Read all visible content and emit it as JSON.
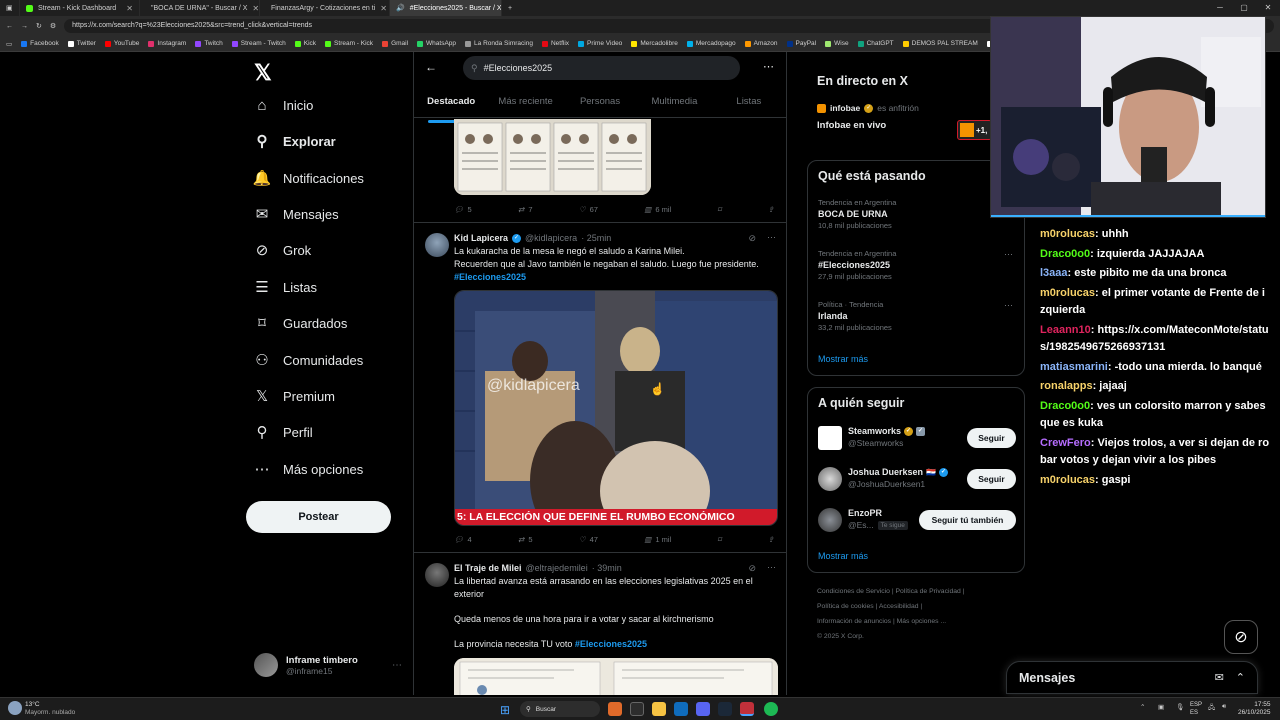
{
  "browser": {
    "tabs": [
      {
        "label": "Stream - Kick Dashboard",
        "color": "#53fc18"
      },
      {
        "label": "\"BOCA DE URNA\" - Buscar / X",
        "color": "#ffffff"
      },
      {
        "label": "FinanzasArgy - Cotizaciones en ti",
        "color": "#1a73e8"
      },
      {
        "label": "#Elecciones2025 - Buscar / X",
        "color": "#ffffff"
      }
    ],
    "url": "https://x.com/search?q=%23Elecciones2025&src=trend_click&vertical=trends",
    "bookmarks": [
      {
        "label": "Facebook",
        "color": "#1877f2"
      },
      {
        "label": "Twitter",
        "color": "#ffffff"
      },
      {
        "label": "YouTube",
        "color": "#ff0000"
      },
      {
        "label": "Instagram",
        "color": "#e1306c"
      },
      {
        "label": "Twitch",
        "color": "#9146ff"
      },
      {
        "label": "Stream - Twitch",
        "color": "#9146ff"
      },
      {
        "label": "Kick",
        "color": "#53fc18"
      },
      {
        "label": "Stream - Kick",
        "color": "#53fc18"
      },
      {
        "label": "Gmail",
        "color": "#ea4335"
      },
      {
        "label": "WhatsApp",
        "color": "#25d366"
      },
      {
        "label": "La Ronda Simracing",
        "color": "#999999"
      },
      {
        "label": "Netflix",
        "color": "#e50914"
      },
      {
        "label": "Prime Video",
        "color": "#00a8e1"
      },
      {
        "label": "Mercadolibre",
        "color": "#ffe600"
      },
      {
        "label": "Mercadopago",
        "color": "#00b1ea"
      },
      {
        "label": "Amazon",
        "color": "#ff9900"
      },
      {
        "label": "PayPal",
        "color": "#003087"
      },
      {
        "label": "Wise",
        "color": "#9fe870"
      },
      {
        "label": "ChatGPT",
        "color": "#10a37f"
      },
      {
        "label": "DEMOS PAL STREAM",
        "color": "#ffcc00"
      },
      {
        "label": "JUAN TUR",
        "color": "#ffffff"
      }
    ]
  },
  "sidebar": {
    "items": [
      {
        "label": "Inicio",
        "icon": "home-icon",
        "glyph": "⌂"
      },
      {
        "label": "Explorar",
        "icon": "search-icon",
        "glyph": "⚲"
      },
      {
        "label": "Notificaciones",
        "icon": "bell-icon",
        "glyph": "🔔"
      },
      {
        "label": "Mensajes",
        "icon": "envelope-icon",
        "glyph": "✉"
      },
      {
        "label": "Grok",
        "icon": "grok-icon",
        "glyph": "⊘"
      },
      {
        "label": "Listas",
        "icon": "list-icon",
        "glyph": "☰"
      },
      {
        "label": "Guardados",
        "icon": "bookmark-icon",
        "glyph": "⌑"
      },
      {
        "label": "Comunidades",
        "icon": "communities-icon",
        "glyph": "⚇"
      },
      {
        "label": "Premium",
        "icon": "x-premium-icon",
        "glyph": "𝕏"
      },
      {
        "label": "Perfil",
        "icon": "profile-icon",
        "glyph": "⚲"
      },
      {
        "label": "Más opciones",
        "icon": "more-icon",
        "glyph": "⋯"
      }
    ],
    "post_label": "Postear",
    "profile": {
      "name": "Inframe timbero",
      "handle": "@inframe15"
    }
  },
  "search": {
    "query": "#Elecciones2025"
  },
  "tabs": [
    "Destacado",
    "Más reciente",
    "Personas",
    "Multimedia",
    "Listas"
  ],
  "tweets": [
    {
      "stats": {
        "replies": "5",
        "retweets": "7",
        "likes": "67",
        "views": "6 mil"
      }
    },
    {
      "author": "Kid Lapicera",
      "handle": "@kidlapicera",
      "time": "· 25min",
      "line1": "La kukaracha de la mesa le negó el saludo a Karina Milei.",
      "line2": "Recuerden que al Javo también le negaban el saludo. Luego fue presidente.",
      "hashtag": "#Elecciones2025",
      "video_watermark": "@kidlapicera",
      "video_caption": "5: LA ELECCIÓN QUE DEFINE EL RUMBO ECONÓMICO",
      "stats": {
        "replies": "4",
        "retweets": "5",
        "likes": "47",
        "views": "1 mil"
      }
    },
    {
      "author": "El Traje de Milei",
      "handle": "@eltrajedemilei",
      "time": "· 39min",
      "line1": "La libertad avanza está arrasando en las elecciones legislativas 2025 en el exterior",
      "line2": "Queda menos de una hora para ir a votar y sacar al kirchnerismo",
      "line3": "La provincia necesita TU voto",
      "hashtag": "#Elecciones2025"
    }
  ],
  "right": {
    "live": {
      "title": "En directo en X",
      "host": "infobae",
      "host_role": "es anfitrión",
      "name": "Infobae en vivo",
      "extra": "+1,"
    },
    "trends": {
      "title": "Qué está pasando",
      "items": [
        {
          "context": "Tendencia en Argentina",
          "name": "BOCA DE URNA",
          "count": "10,8 mil publicaciones"
        },
        {
          "context": "Tendencia en Argentina",
          "name": "#Elecciones2025",
          "count": "27,9 mil publicaciones"
        },
        {
          "context": "Política · Tendencia",
          "name": "Irlanda",
          "count": "33,2 mil publicaciones"
        }
      ],
      "more": "Mostrar más"
    },
    "follow": {
      "title": "A quién seguir",
      "items": [
        {
          "name": "Steamworks",
          "handle": "@Steamworks",
          "button": "Seguir"
        },
        {
          "name": "Joshua Duerksen",
          "handle": "@JoshuaDuerksen1",
          "button": "Seguir"
        },
        {
          "name": "EnzoPR",
          "handle": "@Es...",
          "badge": "Te sigue",
          "button": "Seguir tú también"
        }
      ],
      "more": "Mostrar más"
    },
    "footer": [
      "Condiciones de Servicio",
      "|",
      "Política de Privacidad",
      "|",
      "Política de cookies",
      "|",
      "Accesibilidad",
      "|",
      "Información de anuncios",
      "|",
      "Más opciones ...",
      "© 2025 X Corp."
    ]
  },
  "chat": [
    {
      "user": "m0rolucas",
      "color": "#f7d26a",
      "text": ": uhhh"
    },
    {
      "user": "Draco0o0",
      "color": "#53fc18",
      "text": ": izquierda JAJJAJAA"
    },
    {
      "user": "l3aaa",
      "color": "#8ab4f8",
      "text": ": este pibito me da una bronca"
    },
    {
      "user": "m0rolucas",
      "color": "#f7d26a",
      "text": ": el primer votante de Frente de izquierda"
    },
    {
      "user": "Leaann10",
      "color": "#e0245e",
      "text": ": https://x.com/MateconMote/status/1982549675266937131"
    },
    {
      "user": "matiasmarini",
      "color": "#8ab4f8",
      "text": ": -todo una mierda. lo banqué"
    },
    {
      "user": "ronalapps",
      "color": "#f7d26a",
      "text": ": jajaaj"
    },
    {
      "user": "Draco0o0",
      "color": "#53fc18",
      "text": ": ves un colorsito marron y sabes que es kuka"
    },
    {
      "user": "CrewFero",
      "color": "#b66dff",
      "text": ": Viejos trolos, a ver si dejan de robar votos y dejan vivir a los pibes"
    },
    {
      "user": "m0rolucas",
      "color": "#f7d26a",
      "text": ": gaspi"
    }
  ],
  "messages": {
    "title": "Mensajes"
  },
  "taskbar": {
    "weather_temp": "13°C",
    "weather_desc": "Mayorm. nublado",
    "search": "Buscar",
    "lang": "ESP\nES",
    "time": "17:55",
    "date": "26/10/2025"
  }
}
